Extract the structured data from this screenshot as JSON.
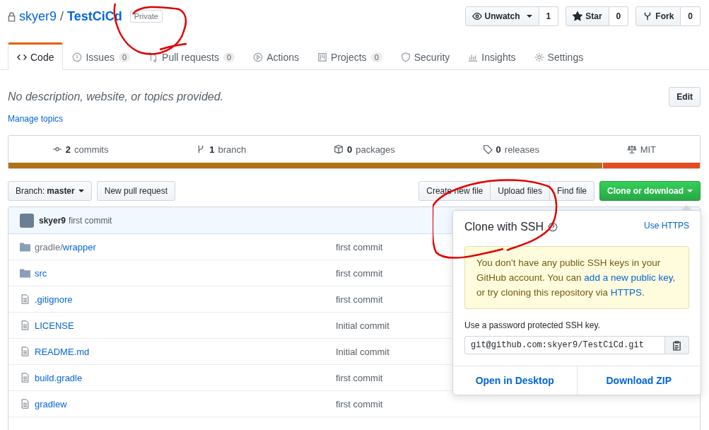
{
  "repo": {
    "owner": "skyer9",
    "separator": "/",
    "name": "TestCiCd",
    "badge": "Private"
  },
  "actions": [
    {
      "kind": "eye",
      "label": "Unwatch",
      "count": "1",
      "dropdown": true
    },
    {
      "kind": "star",
      "label": "Star",
      "count": "0",
      "dropdown": false
    },
    {
      "kind": "fork",
      "label": "Fork",
      "count": "0",
      "dropdown": false
    }
  ],
  "tabs": [
    {
      "kind": "code",
      "label": "Code",
      "selected": true
    },
    {
      "kind": "issue",
      "label": "Issues",
      "count": "0",
      "selected": false
    },
    {
      "kind": "pr",
      "label": "Pull requests",
      "count": "0",
      "selected": false
    },
    {
      "kind": "play",
      "label": "Actions",
      "selected": false
    },
    {
      "kind": "project",
      "label": "Projects",
      "count": "0",
      "selected": false
    },
    {
      "kind": "shield",
      "label": "Security",
      "selected": false
    },
    {
      "kind": "graph",
      "label": "Insights",
      "selected": false
    },
    {
      "kind": "gear",
      "label": "Settings",
      "selected": false
    }
  ],
  "description": "No description, website, or topics provided.",
  "edit_button": "Edit",
  "manage_topics": "Manage topics",
  "summary": [
    {
      "kind": "commits",
      "count": "2",
      "label": "commits"
    },
    {
      "kind": "branch",
      "count": "1",
      "label": "branch"
    },
    {
      "kind": "package",
      "count": "0",
      "label": "packages"
    },
    {
      "kind": "tag",
      "count": "0",
      "label": "releases"
    },
    {
      "kind": "law",
      "label": "MIT"
    }
  ],
  "languages": [
    {
      "color": "#b07219",
      "level": 0.86
    },
    {
      "color": "#e44b23",
      "level": 0.14
    }
  ],
  "branch": {
    "label": "Branch:",
    "value": "master"
  },
  "new_pr": "New pull request",
  "file_buttons": [
    "Create new file",
    "Upload files",
    "Find file"
  ],
  "clone_button": "Clone or download",
  "commit": {
    "author": "skyer9",
    "message": "first commit"
  },
  "files": [
    {
      "kind": "folder",
      "prefix": "gradle/",
      "name": "wrapper",
      "message": "first commit"
    },
    {
      "kind": "folder",
      "name": "src",
      "message": "first commit"
    },
    {
      "kind": "file",
      "name": ".gitignore",
      "message": "first commit"
    },
    {
      "kind": "file",
      "name": "LICENSE",
      "message": "Initial commit"
    },
    {
      "kind": "file",
      "name": "README.md",
      "message": "Initial commit"
    },
    {
      "kind": "file",
      "name": "build.gradle",
      "message": "first commit"
    },
    {
      "kind": "file",
      "name": "gradlew",
      "message": "first commit"
    }
  ],
  "clone_popup": {
    "title": "Clone with SSH",
    "switch_link": "Use HTTPS",
    "notice": [
      {
        "kind": "text",
        "text": "You don't have any public SSH keys in your GitHub account. You can "
      },
      {
        "kind": "link",
        "text": "add a new public key"
      },
      {
        "kind": "text",
        "text": ", or try cloning this repository via "
      },
      {
        "kind": "link",
        "text": "HTTPS"
      },
      {
        "kind": "text",
        "text": "."
      }
    ],
    "hint": "Use a password protected SSH key.",
    "url": "git@github.com:skyer9/TestCiCd.git",
    "footer": [
      "Open in Desktop",
      "Download ZIP"
    ]
  }
}
